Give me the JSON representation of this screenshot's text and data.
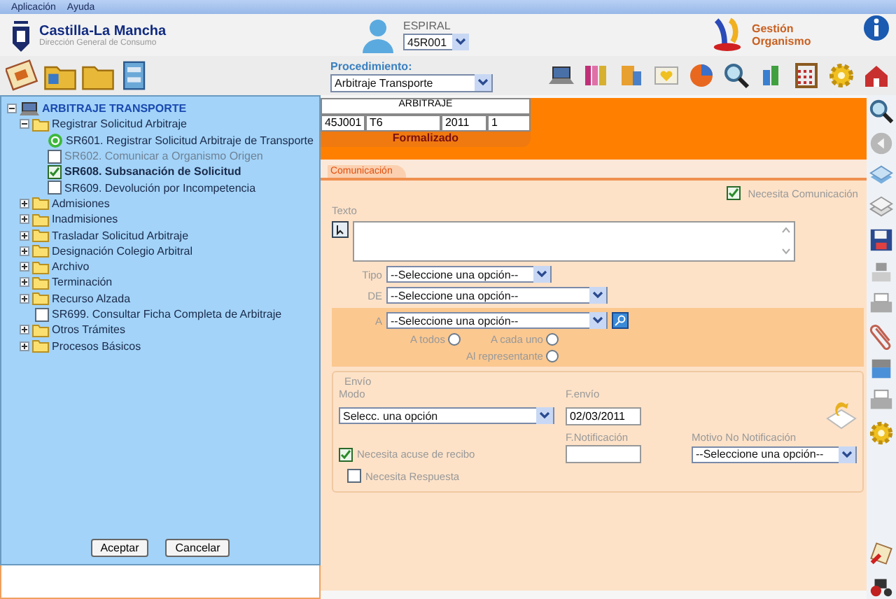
{
  "menu": [
    {
      "label": "Aplicación"
    },
    {
      "label": "Ayuda"
    }
  ],
  "header": {
    "logo_title": "Castilla-La Mancha",
    "logo_subtitle": "Dirección General de Consumo",
    "user_label": "ESPIRAL",
    "user_select": "45R001",
    "module": "Gestión Organismo"
  },
  "procedure": {
    "label": "Procedimiento:",
    "value": "Arbitraje Transporte"
  },
  "tree": {
    "label": "ARBITRAJE TRANSPORTE",
    "expanded": true,
    "children": [
      {
        "kind": "folder",
        "label": "Registrar Solicitud Arbitraje",
        "expanded": true,
        "children": [
          {
            "kind": "task",
            "label": "SR601. Registrar Solicitud Arbitraje de Transporte",
            "done": true,
            "disabled": false,
            "selected": false
          },
          {
            "kind": "task",
            "label": "SR602. Comunicar a Organismo Origen",
            "done": false,
            "checked": false,
            "disabled": true,
            "selected": false
          },
          {
            "kind": "task",
            "label": "SR608. Subsanación de Solicitud",
            "done": false,
            "checked": true,
            "disabled": false,
            "selected": true
          },
          {
            "kind": "task",
            "label": "SR609. Devolución por Incompetencia",
            "done": false,
            "checked": false,
            "disabled": false,
            "selected": false
          }
        ]
      },
      {
        "kind": "folder",
        "label": "Admisiones",
        "expanded": false
      },
      {
        "kind": "folder",
        "label": "Inadmisiones",
        "expanded": false
      },
      {
        "kind": "folder",
        "label": "Trasladar Solicitud Arbitraje",
        "expanded": false
      },
      {
        "kind": "folder",
        "label": "Designación Colegio Arbitral",
        "expanded": false
      },
      {
        "kind": "folder",
        "label": "Archivo",
        "expanded": false
      },
      {
        "kind": "folder",
        "label": "Terminación",
        "expanded": false
      },
      {
        "kind": "folder",
        "label": "Recurso Alzada",
        "expanded": false
      },
      {
        "kind": "task",
        "label": "SR699. Consultar Ficha Completa de Arbitraje",
        "done": false,
        "checked": false,
        "disabled": false,
        "selected": false
      },
      {
        "kind": "folder",
        "label": "Otros Trámites",
        "expanded": false
      },
      {
        "kind": "folder",
        "label": "Procesos Básicos",
        "expanded": false
      }
    ]
  },
  "tree_buttons": [
    "Aceptar",
    "Cancelar"
  ],
  "record": {
    "title": "ARBITRAJE",
    "cells": [
      "45J001",
      "T6",
      "2011",
      "1"
    ],
    "status": "Formalizado"
  },
  "tabs": [
    {
      "label": "Comunicación",
      "selected": true
    }
  ],
  "form": {
    "needs_communication": {
      "label": "Necesita Comunicación",
      "checked": true
    },
    "text_label": "Texto",
    "tipo": {
      "label": "Tipo",
      "value": "--Seleccione una opción--"
    },
    "de": {
      "label": "DE",
      "value": "--Seleccione una opción--"
    },
    "a": {
      "label": "A",
      "value": "--Seleccione una opción--"
    },
    "radios": [
      {
        "label": "A todos",
        "selected": false
      },
      {
        "label": "A cada uno",
        "selected": false
      },
      {
        "label": "Al representante",
        "selected": false
      }
    ],
    "envio": {
      "legend": "Envío",
      "mode_label": "Modo",
      "mode_value": "Selecc. una opción",
      "date_label": "F.envío",
      "date_value": "02/03/2011",
      "notif_label": "F.Notificación",
      "reason_label": "Motivo No Notificación",
      "reason_value": "--Seleccione una opción--",
      "ack": {
        "label": "Necesita acuse de recibo",
        "checked": true
      },
      "reply": {
        "label": "Necesita Respuesta",
        "checked": false
      }
    }
  }
}
